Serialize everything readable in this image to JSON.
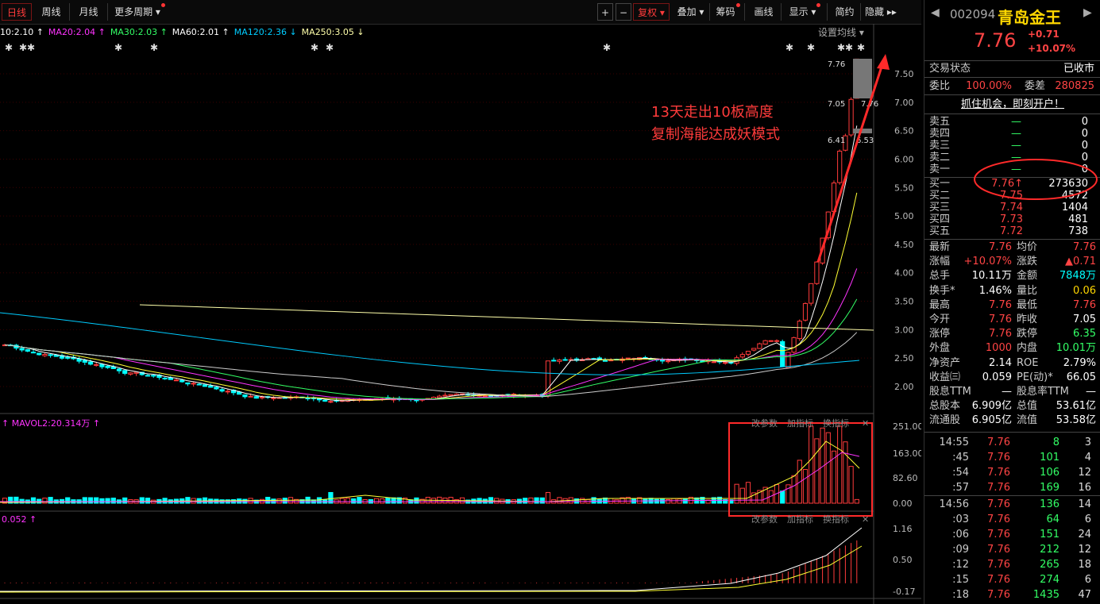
{
  "toolbar": {
    "tabs": [
      "日线",
      "周线",
      "月线",
      "更多周期"
    ],
    "plus": "+",
    "minus": "−",
    "right_buttons": [
      "复权",
      "叠加",
      "筹码",
      "画线",
      "显示",
      "简约",
      "隐藏"
    ]
  },
  "ma_legend": [
    {
      "label": "10:2.10",
      "color": "#ffffff"
    },
    {
      "label": "MA20:2.04",
      "color": "#ff33ff"
    },
    {
      "label": "MA30:2.03",
      "color": "#33ff66"
    },
    {
      "label": "MA60:2.01",
      "color": "#ffffff"
    },
    {
      "label": "MA120:2.36",
      "color": "#00ccff"
    },
    {
      "label": "MA250:3.05",
      "color": "#ffffaa"
    }
  ],
  "set_ma_label": "设置均线",
  "annotation": [
    "13天走出10板高度",
    "复制海能达成妖模式"
  ],
  "price_axis": [
    "7.50",
    "7.00",
    "6.50",
    "6.00",
    "5.50",
    "5.00",
    "4.50",
    "4.00",
    "3.50",
    "3.00",
    "2.50",
    "2.00"
  ],
  "price_marks": {
    "top": "7.76",
    "p705": "7.05",
    "p776": "7.76",
    "p641": "6.41",
    "p653": "6.53"
  },
  "vol_panel": {
    "legend": "MAVOL2:20.314万",
    "axis": [
      "251.00",
      "163.00",
      "82.60",
      "0.00"
    ],
    "controls": [
      "改参数",
      "加指标",
      "换指标"
    ]
  },
  "macd_panel": {
    "legend": "0.052",
    "axis": [
      "1.16",
      "0.50",
      "-0.17"
    ],
    "controls": [
      "改参数",
      "加指标",
      "换指标"
    ]
  },
  "quote": {
    "code": "002094",
    "name": "青岛金王",
    "price": "7.76",
    "change": "+0.71",
    "pct": "+10.07%",
    "status_label": "交易状态",
    "status": "已收市",
    "weibi_label": "委比",
    "weibi": "100.00%",
    "weicha_label": "委差",
    "weicha": "280825",
    "promo": "抓住机会，即刻开户！",
    "asks": [
      {
        "label": "卖五",
        "price": "—",
        "vol": "0"
      },
      {
        "label": "卖四",
        "price": "—",
        "vol": "0"
      },
      {
        "label": "卖三",
        "price": "—",
        "vol": "0"
      },
      {
        "label": "卖二",
        "price": "—",
        "vol": "0"
      },
      {
        "label": "卖一",
        "price": "—",
        "vol": "0"
      }
    ],
    "bids": [
      {
        "label": "买一",
        "price": "7.76↑",
        "vol": "273630"
      },
      {
        "label": "买二",
        "price": "7.75",
        "vol": "4572"
      },
      {
        "label": "买三",
        "price": "7.74",
        "vol": "1404"
      },
      {
        "label": "买四",
        "price": "7.73",
        "vol": "481"
      },
      {
        "label": "买五",
        "price": "7.72",
        "vol": "738"
      }
    ],
    "stats": [
      [
        "最新",
        "7.76",
        "均价",
        "7.76"
      ],
      [
        "涨幅",
        "+10.07%",
        "涨跌",
        "▲0.71"
      ],
      [
        "总手",
        "10.11万",
        "金额",
        "7848万"
      ],
      [
        "换手*",
        "1.46%",
        "量比",
        "0.06"
      ],
      [
        "最高",
        "7.76",
        "最低",
        "7.76"
      ],
      [
        "今开",
        "7.76",
        "昨收",
        "7.05"
      ],
      [
        "涨停",
        "7.76",
        "跌停",
        "6.35"
      ],
      [
        "外盘",
        "1000",
        "内盘",
        "10.01万"
      ],
      [
        "净资产",
        "2.14",
        "ROE",
        "2.79%"
      ],
      [
        "收益㈢",
        "0.059",
        "PE(动)*",
        "66.05"
      ],
      [
        "股息TTM",
        "—",
        "股息率TTM",
        "—"
      ],
      [
        "总股本",
        "6.909亿",
        "总值",
        "53.61亿"
      ],
      [
        "流通股",
        "6.905亿",
        "流值",
        "53.58亿"
      ]
    ],
    "ticks": [
      {
        "t": "14:55",
        "p": "7.76",
        "q": "8",
        "n": "3"
      },
      {
        "t": ":45",
        "p": "7.76",
        "q": "101",
        "n": "4"
      },
      {
        "t": ":54",
        "p": "7.76",
        "q": "106",
        "n": "12"
      },
      {
        "t": ":57",
        "p": "7.76",
        "q": "169",
        "n": "16"
      },
      {
        "t": "14:56",
        "p": "7.76",
        "q": "136",
        "n": "14"
      },
      {
        "t": ":03",
        "p": "7.76",
        "q": "64",
        "n": "6"
      },
      {
        "t": ":06",
        "p": "7.76",
        "q": "151",
        "n": "24"
      },
      {
        "t": ":09",
        "p": "7.76",
        "q": "212",
        "n": "12"
      },
      {
        "t": ":12",
        "p": "7.76",
        "q": "265",
        "n": "18"
      },
      {
        "t": ":15",
        "p": "7.76",
        "q": "274",
        "n": "6"
      },
      {
        "t": ":18",
        "p": "7.76",
        "q": "1435",
        "n": "47"
      }
    ]
  }
}
